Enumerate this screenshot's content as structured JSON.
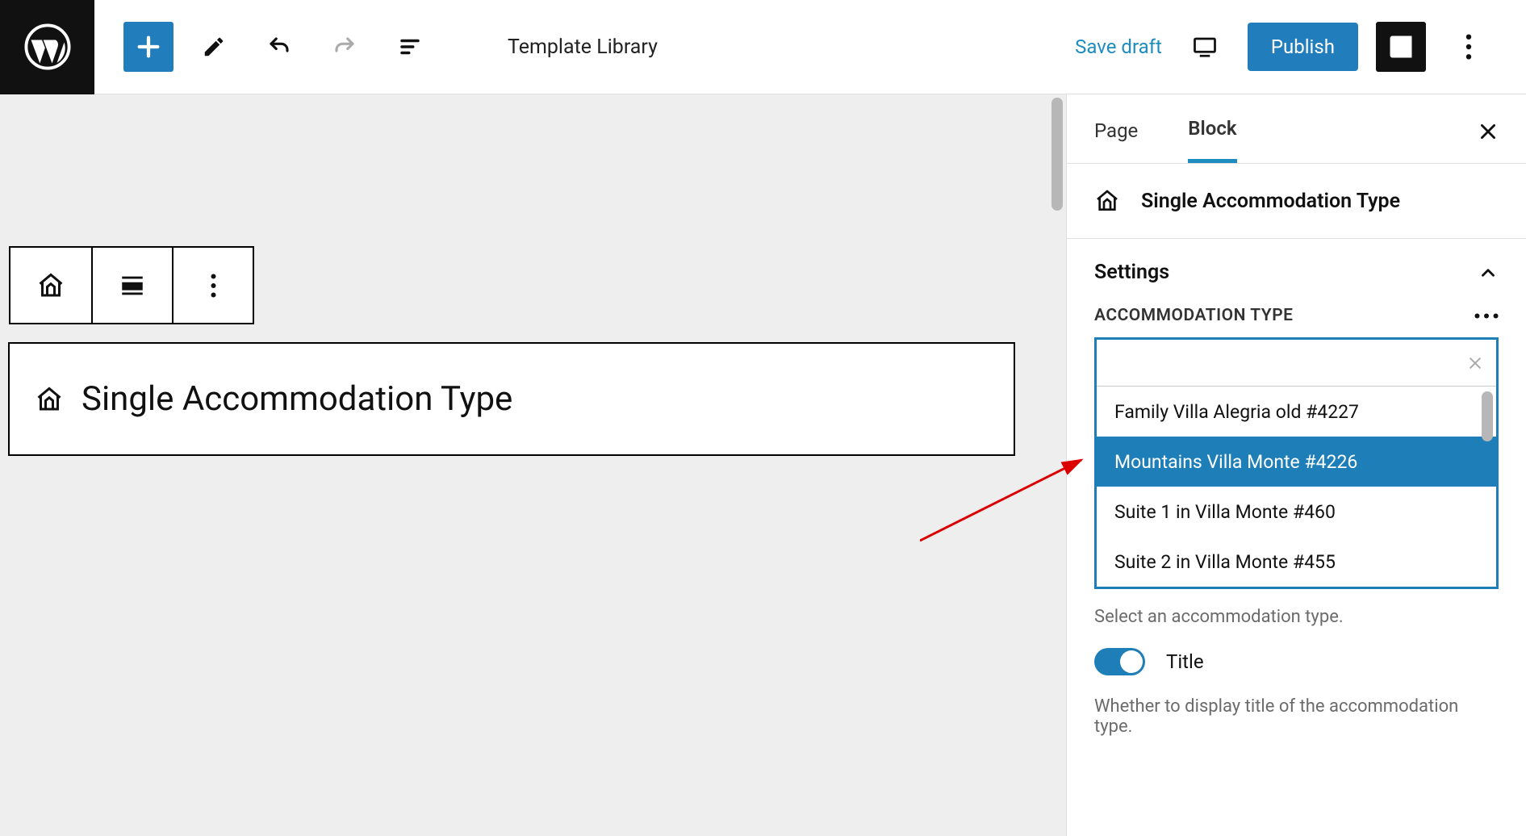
{
  "topbar": {
    "template_library": "Template Library",
    "save_draft": "Save draft",
    "publish": "Publish"
  },
  "block_toolbar": {
    "icon1": "home",
    "icon2": "align",
    "icon3": "more"
  },
  "block_card": {
    "title": "Single Accommodation Type"
  },
  "sidebar": {
    "tabs": {
      "page": "Page",
      "block": "Block",
      "active": "Block"
    },
    "block_identity": "Single Accommodation Type",
    "settings_label": "Settings",
    "section_label": "ACCOMMODATION TYPE",
    "combo": {
      "value": "",
      "options": [
        "Family Villa Alegria old #4227",
        "Mountains Villa Monte #4226",
        "Suite 1 in Villa Monte #460",
        "Suite 2 in Villa Monte #455"
      ],
      "selected_index": 1
    },
    "combo_help": "Select an accommodation type.",
    "title_toggle": {
      "label": "Title",
      "on": true
    },
    "title_help": "Whether to display title of the accommodation type."
  },
  "colors": {
    "accent": "#1e7fb8"
  }
}
